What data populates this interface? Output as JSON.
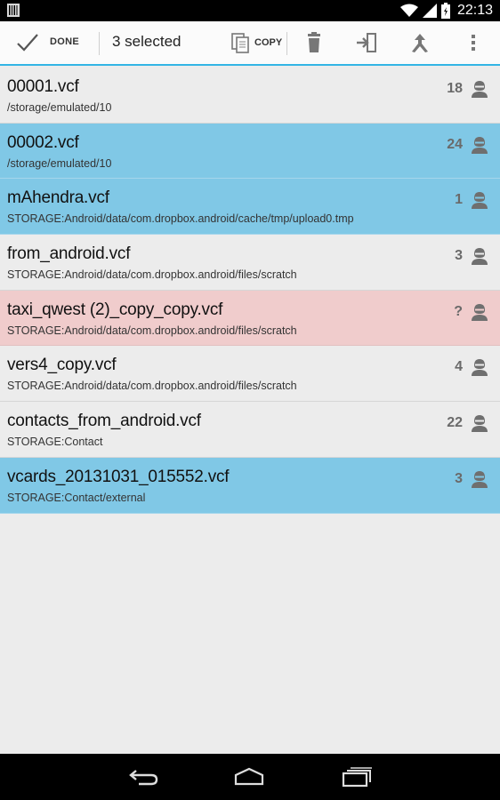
{
  "status_bar": {
    "time": "22:13",
    "icons": [
      "barcode-icon",
      "wifi-icon",
      "signal-icon",
      "battery-icon"
    ]
  },
  "action_bar": {
    "done_label": "DONE",
    "title": "3 selected",
    "copy_label": "COPY",
    "icons": [
      "check-icon",
      "copy-icon",
      "delete-icon",
      "import-icon",
      "merge-icon",
      "overflow-menu-icon"
    ],
    "accent_color": "#33b5e5"
  },
  "files": [
    {
      "name": "00001.vcf",
      "path": "/storage/emulated/10",
      "count": "18",
      "state": "normal"
    },
    {
      "name": "00002.vcf",
      "path": "/storage/emulated/10",
      "count": "24",
      "state": "selected"
    },
    {
      "name": "mAhendra.vcf",
      "path": "STORAGE:Android/data/com.dropbox.android/cache/tmp/upload0.tmp",
      "count": "1",
      "state": "selected"
    },
    {
      "name": "from_android.vcf",
      "path": "STORAGE:Android/data/com.dropbox.android/files/scratch",
      "count": "3",
      "state": "normal"
    },
    {
      "name": "taxi_qwest (2)_copy_copy.vcf",
      "path": "STORAGE:Android/data/com.dropbox.android/files/scratch",
      "count": "?",
      "state": "error"
    },
    {
      "name": "vers4_copy.vcf",
      "path": "STORAGE:Android/data/com.dropbox.android/files/scratch",
      "count": "4",
      "state": "normal"
    },
    {
      "name": "contacts_from_android.vcf",
      "path": "STORAGE:Contact",
      "count": "22",
      "state": "normal"
    },
    {
      "name": "vcards_20131031_015552.vcf",
      "path": "STORAGE:Contact/external",
      "count": "3",
      "state": "selected"
    }
  ],
  "colors": {
    "selected_row": "#80c8e6",
    "error_row": "#f0cccc",
    "normal_row": "#ececec"
  },
  "nav_bar": {
    "icons": [
      "back-icon",
      "home-icon",
      "recents-icon"
    ]
  }
}
